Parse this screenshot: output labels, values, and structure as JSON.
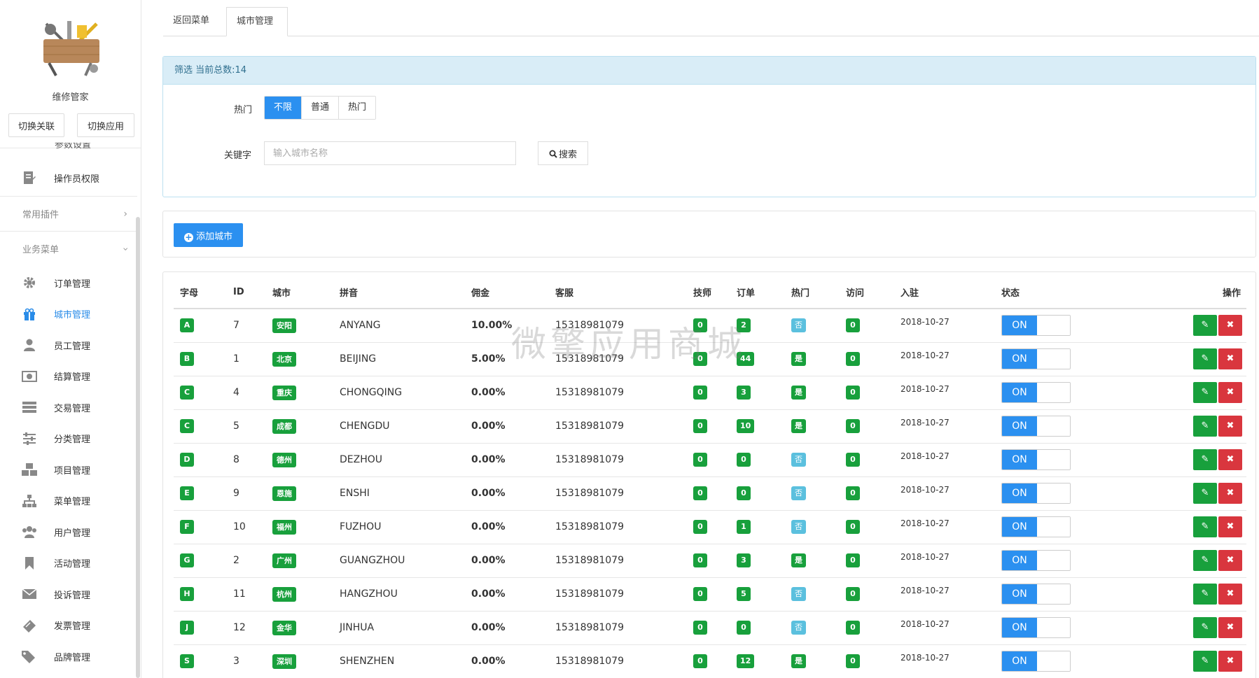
{
  "sidebar": {
    "brand_name": "维修管家",
    "switch_link_label": "切换关联",
    "switch_app_label": "切换应用",
    "partial_item_label": "参数设置",
    "top_items": [
      {
        "label": "操作员权限",
        "icon": "edit-doc-icon"
      }
    ],
    "groups": [
      {
        "label": "常用插件",
        "icon": "chevron-right-icon"
      },
      {
        "label": "业务菜单",
        "icon": "chevron-down-icon"
      }
    ],
    "items": [
      {
        "label": "订单管理",
        "icon": "gear-icon"
      },
      {
        "label": "城市管理",
        "icon": "gift-icon"
      },
      {
        "label": "员工管理",
        "icon": "user-icon"
      },
      {
        "label": "结算管理",
        "icon": "money-icon"
      },
      {
        "label": "交易管理",
        "icon": "server-icon"
      },
      {
        "label": "分类管理",
        "icon": "sliders-icon"
      },
      {
        "label": "项目管理",
        "icon": "cubes-icon"
      },
      {
        "label": "菜单管理",
        "icon": "sitemap-icon"
      },
      {
        "label": "用户管理",
        "icon": "users-icon"
      },
      {
        "label": "活动管理",
        "icon": "bookmark-icon"
      },
      {
        "label": "投诉管理",
        "icon": "envelope-icon"
      },
      {
        "label": "发票管理",
        "icon": "ticket-icon"
      },
      {
        "label": "品牌管理",
        "icon": "tags-icon"
      }
    ],
    "active_index": 1
  },
  "tabs": [
    {
      "label": "返回菜单"
    },
    {
      "label": "城市管理"
    }
  ],
  "filter": {
    "title": "筛选 当前总数:14",
    "hot_label": "热门",
    "hot_options": [
      "不限",
      "普通",
      "热门"
    ],
    "hot_selected": "不限",
    "keyword_label": "关键字",
    "keyword_placeholder": "输入城市名称",
    "keyword_value": "",
    "search_label": "搜索"
  },
  "add_city_label": "添加城市",
  "table": {
    "headers": [
      "字母",
      "ID",
      "城市",
      "拼音",
      "佣金",
      "客服",
      "技师",
      "订单",
      "热门",
      "访问",
      "入驻",
      "状态",
      "操作"
    ],
    "rows": [
      {
        "letter": "A",
        "id": "7",
        "city": "安阳",
        "pinyin": "ANYANG",
        "commission": "10.00%",
        "service": "15318981079",
        "tech": "0",
        "orders": "2",
        "hot": "否",
        "hot_flag": false,
        "visits": "0",
        "joined": "2018-10-27",
        "status": "ON"
      },
      {
        "letter": "B",
        "id": "1",
        "city": "北京",
        "pinyin": "BEIJING",
        "commission": "5.00%",
        "service": "15318981079",
        "tech": "0",
        "orders": "44",
        "hot": "是",
        "hot_flag": true,
        "visits": "0",
        "joined": "2018-10-27",
        "status": "ON"
      },
      {
        "letter": "C",
        "id": "4",
        "city": "重庆",
        "pinyin": "CHONGQING",
        "commission": "0.00%",
        "service": "15318981079",
        "tech": "0",
        "orders": "3",
        "hot": "是",
        "hot_flag": true,
        "visits": "0",
        "joined": "2018-10-27",
        "status": "ON"
      },
      {
        "letter": "C",
        "id": "5",
        "city": "成都",
        "pinyin": "CHENGDU",
        "commission": "0.00%",
        "service": "15318981079",
        "tech": "0",
        "orders": "10",
        "hot": "是",
        "hot_flag": true,
        "visits": "0",
        "joined": "2018-10-27",
        "status": "ON"
      },
      {
        "letter": "D",
        "id": "8",
        "city": "德州",
        "pinyin": "DEZHOU",
        "commission": "0.00%",
        "service": "15318981079",
        "tech": "0",
        "orders": "0",
        "hot": "否",
        "hot_flag": false,
        "visits": "0",
        "joined": "2018-10-27",
        "status": "ON"
      },
      {
        "letter": "E",
        "id": "9",
        "city": "恩施",
        "pinyin": "ENSHI",
        "commission": "0.00%",
        "service": "15318981079",
        "tech": "0",
        "orders": "0",
        "hot": "否",
        "hot_flag": false,
        "visits": "0",
        "joined": "2018-10-27",
        "status": "ON"
      },
      {
        "letter": "F",
        "id": "10",
        "city": "福州",
        "pinyin": "FUZHOU",
        "commission": "0.00%",
        "service": "15318981079",
        "tech": "0",
        "orders": "1",
        "hot": "否",
        "hot_flag": false,
        "visits": "0",
        "joined": "2018-10-27",
        "status": "ON"
      },
      {
        "letter": "G",
        "id": "2",
        "city": "广州",
        "pinyin": "GUANGZHOU",
        "commission": "0.00%",
        "service": "15318981079",
        "tech": "0",
        "orders": "3",
        "hot": "是",
        "hot_flag": true,
        "visits": "0",
        "joined": "2018-10-27",
        "status": "ON"
      },
      {
        "letter": "H",
        "id": "11",
        "city": "杭州",
        "pinyin": "HANGZHOU",
        "commission": "0.00%",
        "service": "15318981079",
        "tech": "0",
        "orders": "5",
        "hot": "否",
        "hot_flag": false,
        "visits": "0",
        "joined": "2018-10-27",
        "status": "ON"
      },
      {
        "letter": "J",
        "id": "12",
        "city": "金华",
        "pinyin": "JINHUA",
        "commission": "0.00%",
        "service": "15318981079",
        "tech": "0",
        "orders": "0",
        "hot": "否",
        "hot_flag": false,
        "visits": "0",
        "joined": "2018-10-27",
        "status": "ON"
      },
      {
        "letter": "S",
        "id": "3",
        "city": "深圳",
        "pinyin": "SHENZHEN",
        "commission": "0.00%",
        "service": "15318981079",
        "tech": "0",
        "orders": "12",
        "hot": "是",
        "hot_flag": true,
        "visits": "0",
        "joined": "2018-10-27",
        "status": "ON"
      }
    ]
  },
  "watermark": "微擎应用商城",
  "colors": {
    "primary": "#2b90f0",
    "success": "#18a03c",
    "info": "#5bc0de",
    "danger": "#d9363e"
  }
}
